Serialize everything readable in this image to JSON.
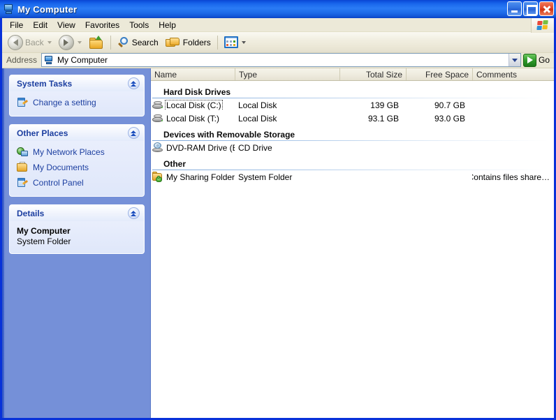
{
  "window": {
    "title": "My Computer",
    "title_icon": "my-computer-icon",
    "minimize_label": "Minimize",
    "maximize_label": "Maximize",
    "close_label": "Close"
  },
  "menu": {
    "items": [
      {
        "label": "File"
      },
      {
        "label": "Edit"
      },
      {
        "label": "View"
      },
      {
        "label": "Favorites"
      },
      {
        "label": "Tools"
      },
      {
        "label": "Help"
      }
    ],
    "brand_icon": "windows-flag-icon"
  },
  "toolbar": {
    "back_label": "Back",
    "back_icon": "back-arrow-icon",
    "back_disabled": true,
    "forward_icon": "forward-arrow-icon",
    "forward_disabled": true,
    "up_icon": "up-folder-icon",
    "search_label": "Search",
    "search_icon": "search-icon",
    "folders_label": "Folders",
    "folders_icon": "folders-icon",
    "views_icon": "views-icon"
  },
  "address": {
    "label": "Address",
    "icon": "my-computer-icon",
    "value": "My Computer",
    "placeholder": "My Computer",
    "dropdown_icon": "chevron-down-icon",
    "go_label": "Go",
    "go_icon": "go-arrow-icon"
  },
  "taskpane": {
    "panels": [
      {
        "title": "System Tasks",
        "collapse_icon": "chevron-up-icon",
        "items": [
          {
            "label": "Change a setting",
            "icon": "control-panel-icon"
          }
        ]
      },
      {
        "title": "Other Places",
        "collapse_icon": "chevron-up-icon",
        "items": [
          {
            "label": "My Network Places",
            "icon": "network-places-icon"
          },
          {
            "label": "My Documents",
            "icon": "my-documents-icon"
          },
          {
            "label": "Control Panel",
            "icon": "control-panel-icon"
          }
        ]
      }
    ],
    "details": {
      "title": "Details",
      "collapse_icon": "chevron-up-icon",
      "name": "My Computer",
      "type": "System Folder"
    }
  },
  "filelist": {
    "columns": [
      {
        "label": "Name",
        "align": "left"
      },
      {
        "label": "Type",
        "align": "left"
      },
      {
        "label": "Total Size",
        "align": "right"
      },
      {
        "label": "Free Space",
        "align": "right"
      },
      {
        "label": "Comments",
        "align": "left"
      }
    ],
    "groups": [
      {
        "title": "Hard Disk Drives",
        "rows": [
          {
            "icon": "hard-disk-icon",
            "name": "Local Disk (C:)",
            "type": "Local Disk",
            "total_size": "139 GB",
            "free_space": "90.7 GB",
            "comments": "",
            "focused": true
          },
          {
            "icon": "hard-disk-icon",
            "name": "Local Disk (T:)",
            "type": "Local Disk",
            "total_size": "93.1 GB",
            "free_space": "93.0 GB",
            "comments": "",
            "focused": false
          }
        ]
      },
      {
        "title": "Devices with Removable Storage",
        "rows": [
          {
            "icon": "cd-drive-icon",
            "name": "DVD-RAM Drive (E:)",
            "type": "CD Drive",
            "total_size": "",
            "free_space": "",
            "comments": "",
            "focused": false
          }
        ]
      },
      {
        "title": "Other",
        "rows": [
          {
            "icon": "shared-folder-icon",
            "name": "My Sharing Folders",
            "type": "System Folder",
            "total_size": "",
            "free_space": "",
            "comments": "Contains files share…",
            "focused": false
          }
        ]
      }
    ]
  },
  "colors": {
    "titlebar_blue": "#1a68ec",
    "window_border": "#0831d9",
    "taskpane_blue": "#7590d8",
    "panel_title": "#1c3fa0",
    "toolbar_beige": "#ece9d8",
    "go_green": "#2f9b2a",
    "close_red": "#cd3212"
  }
}
